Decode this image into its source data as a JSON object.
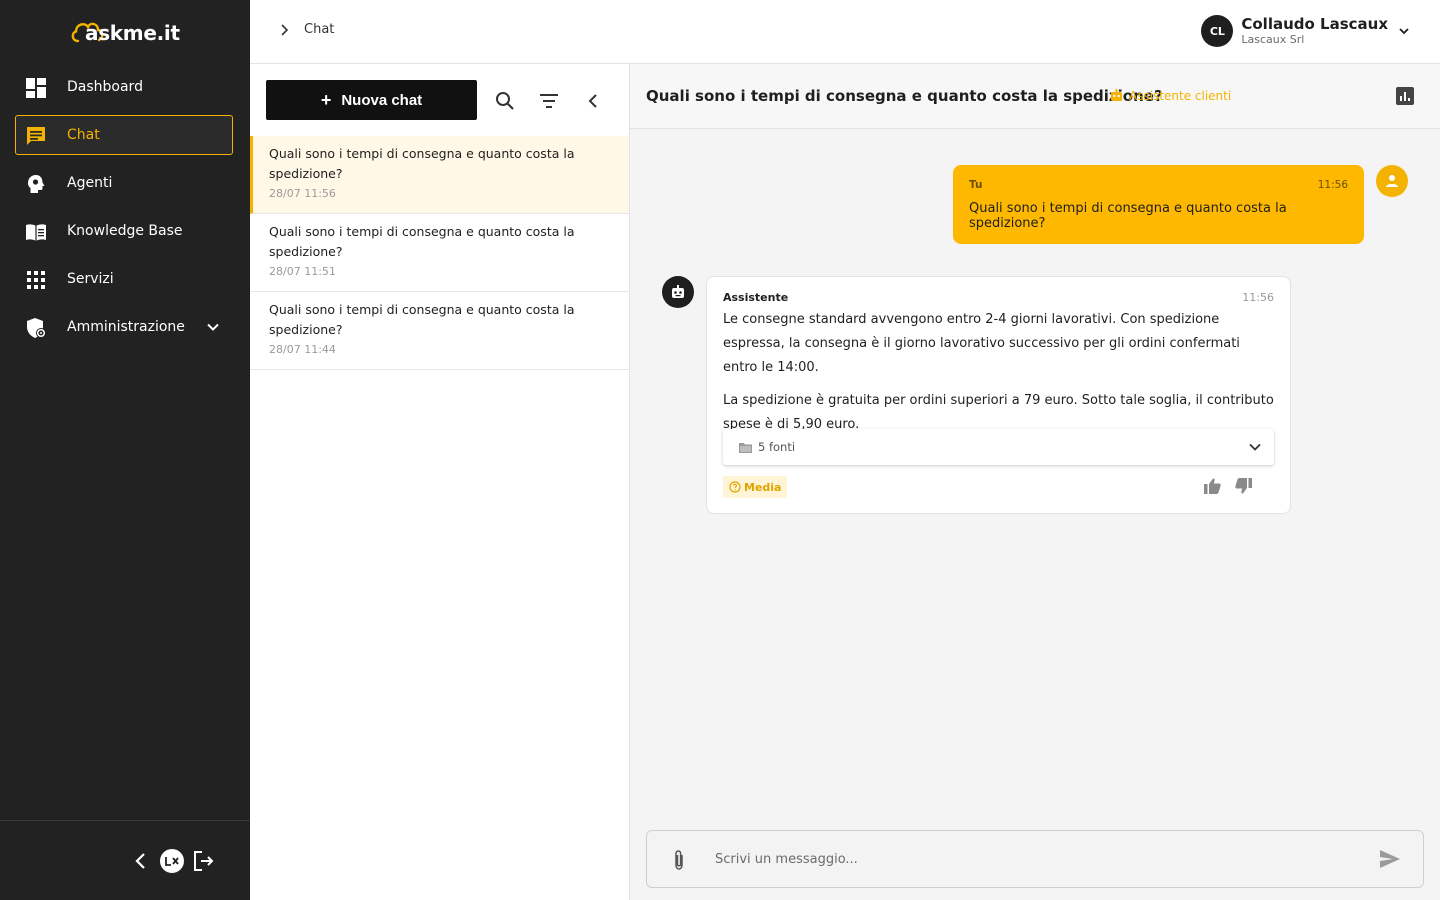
{
  "app": {
    "logo_text": "askme.it"
  },
  "sidebar": {
    "items": [
      {
        "label": "Dashboard",
        "icon": "dashboard-icon"
      },
      {
        "label": "Chat",
        "icon": "chat-icon",
        "active": true
      },
      {
        "label": "Agenti",
        "icon": "agent-head-icon"
      },
      {
        "label": "Knowledge Base",
        "icon": "book-icon"
      },
      {
        "label": "Servizi",
        "icon": "apps-grid-icon"
      },
      {
        "label": "Amministrazione",
        "icon": "admin-shield-icon",
        "expandable": true
      }
    ],
    "bottom": {
      "collapse_icon": "chevron-left-icon",
      "brand_icon": "lx-brand-icon",
      "logout_icon": "logout-icon"
    }
  },
  "topbar": {
    "breadcrumb": "Chat",
    "user": {
      "initials": "CL",
      "name": "Collaudo Lascaux",
      "org": "Lascaux Srl"
    }
  },
  "chat_list": {
    "new_chat_label": "Nuova chat",
    "conversations": [
      {
        "title": "Quali sono i tempi di consegna e quanto costa la spedizione?",
        "time": "28/07 11:56",
        "active": true
      },
      {
        "title": "Quali sono i tempi di consegna e quanto costa la spedizione?",
        "time": "28/07 11:51"
      },
      {
        "title": "Quali sono i tempi di consegna e quanto costa la spedizione?",
        "time": "28/07 11:44"
      }
    ]
  },
  "chat": {
    "title": "Quali sono i tempi di consegna e quanto costa la spedizione?",
    "agent": "Assistente clienti",
    "messages": {
      "user": {
        "author": "Tu",
        "time": "11:56",
        "text": "Quali sono i tempi di consegna e quanto costa la spedizione?"
      },
      "bot": {
        "author": "Assistente",
        "time": "11:56",
        "paragraphs": [
          "Le consegne standard avvengono entro 2-4 giorni lavorativi. Con spedizione espressa, la consegna è il giorno lavorativo successivo per gli ordini confermati entro le 14:00.",
          "La spedizione è gratuita per ordini superiori a 79 euro. Sotto tale soglia, il contributo spese è di 5,90 euro."
        ],
        "sources_label": "5 fonti",
        "confidence": "Media"
      }
    },
    "composer": {
      "placeholder": "Scrivi un messaggio..."
    }
  },
  "colors": {
    "accent": "#f3b300",
    "sidebar_bg": "#222222",
    "user_bubble": "#ffb800"
  }
}
